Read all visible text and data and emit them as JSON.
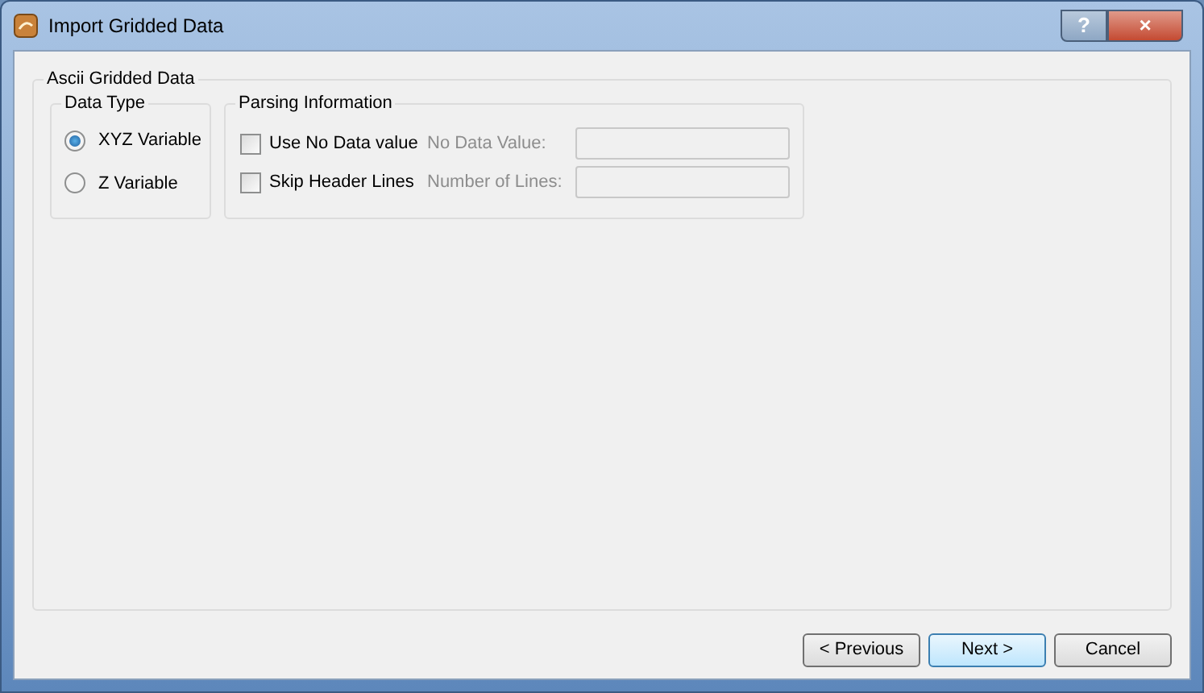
{
  "window": {
    "title": "Import Gridded Data",
    "help_button": "?",
    "close_button": "×"
  },
  "group": {
    "title": "Ascii Gridded Data"
  },
  "data_type": {
    "title": "Data Type",
    "options": [
      {
        "label": "XYZ Variable",
        "selected": true
      },
      {
        "label": "Z Variable",
        "selected": false
      }
    ]
  },
  "parsing": {
    "title": "Parsing Information",
    "rows": [
      {
        "checkbox": "Use No Data value",
        "checked": false,
        "field_label": "No Data Value:",
        "disabled": true
      },
      {
        "checkbox": "Skip Header Lines",
        "checked": false,
        "field_label": "Number of Lines:",
        "disabled": true
      }
    ]
  },
  "buttons": [
    {
      "label": "< Previous",
      "default": false
    },
    {
      "label": "Next >",
      "default": true
    },
    {
      "label": "Cancel",
      "default": false
    }
  ]
}
